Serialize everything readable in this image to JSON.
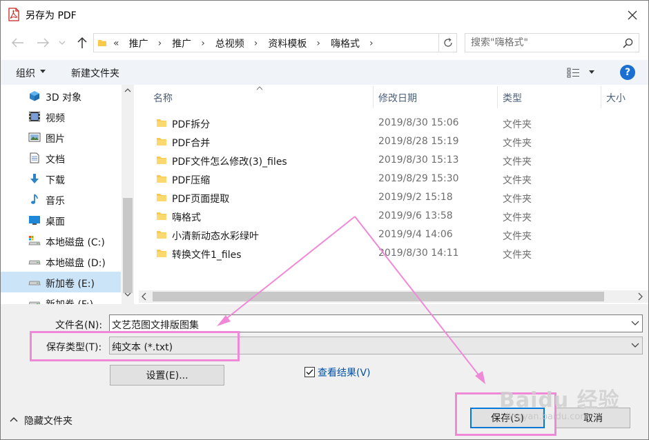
{
  "window": {
    "title": "另存为 PDF",
    "icon": "pdf-icon"
  },
  "address": {
    "lead": "«",
    "crumbs": [
      "推广",
      "推广",
      "总视频",
      "资料模板",
      "嗨格式"
    ]
  },
  "search": {
    "placeholder": "搜索\"嗨格式\""
  },
  "toolbar": {
    "organize_label": "组织",
    "new_folder_label": "新建文件夹",
    "help_label": "?"
  },
  "nav": {
    "items": [
      {
        "label": "3D 对象",
        "icon": "3d-objects-icon"
      },
      {
        "label": "视频",
        "icon": "videos-icon"
      },
      {
        "label": "图片",
        "icon": "pictures-icon"
      },
      {
        "label": "文档",
        "icon": "documents-icon"
      },
      {
        "label": "下载",
        "icon": "downloads-icon"
      },
      {
        "label": "音乐",
        "icon": "music-icon"
      },
      {
        "label": "桌面",
        "icon": "desktop-icon"
      },
      {
        "label": "本地磁盘 (C:)",
        "icon": "drive-c-icon"
      },
      {
        "label": "本地磁盘 (D:)",
        "icon": "drive-d-icon"
      },
      {
        "label": "新加卷 (E:)",
        "icon": "drive-e-icon",
        "selected": true
      },
      {
        "label": "新加卷 (F:)",
        "icon": "drive-f-icon"
      }
    ]
  },
  "list": {
    "columns": {
      "name": "名称",
      "modified": "修改日期",
      "type": "类型",
      "size": "大小"
    },
    "rows": [
      {
        "name": "PDF拆分",
        "modified": "2019/8/30 15:06",
        "type": "文件夹"
      },
      {
        "name": "PDF合并",
        "modified": "2019/8/28 15:19",
        "type": "文件夹"
      },
      {
        "name": "PDF文件怎么修改(3)_files",
        "modified": "2019/8/30 15:13",
        "type": "文件夹"
      },
      {
        "name": "PDF压缩",
        "modified": "2019/8/29 15:30",
        "type": "文件夹"
      },
      {
        "name": "PDF页面提取",
        "modified": "2019/9/2 15:18",
        "type": "文件夹"
      },
      {
        "name": "嗨格式",
        "modified": "2019/9/6 13:58",
        "type": "文件夹"
      },
      {
        "name": "小清新动态水彩绿叶",
        "modified": "2019/9/4 14:06",
        "type": "文件夹"
      },
      {
        "name": "转换文件1_files",
        "modified": "2019/8/30 14:11",
        "type": "文件夹"
      }
    ]
  },
  "form": {
    "filename_label": "文件名(N):",
    "filename_value": "文艺范图文排版图集",
    "savetype_label": "保存类型(T):",
    "savetype_value": "纯文本 (*.txt)",
    "settings_label": "设置(E)...",
    "view_result_label": "查看结果(V)",
    "view_result_checked": true,
    "hide_folders_label": "隐藏文件夹",
    "save_label": "保存(S)",
    "cancel_label": "取消"
  },
  "watermark": {
    "main": "Baidu 经验",
    "sub": "jingyan.baidu.com"
  },
  "colors": {
    "accent": "#0078d7",
    "annotation": "#f088d8",
    "folder": "#f8c94b",
    "selection": "#cce4f7"
  }
}
